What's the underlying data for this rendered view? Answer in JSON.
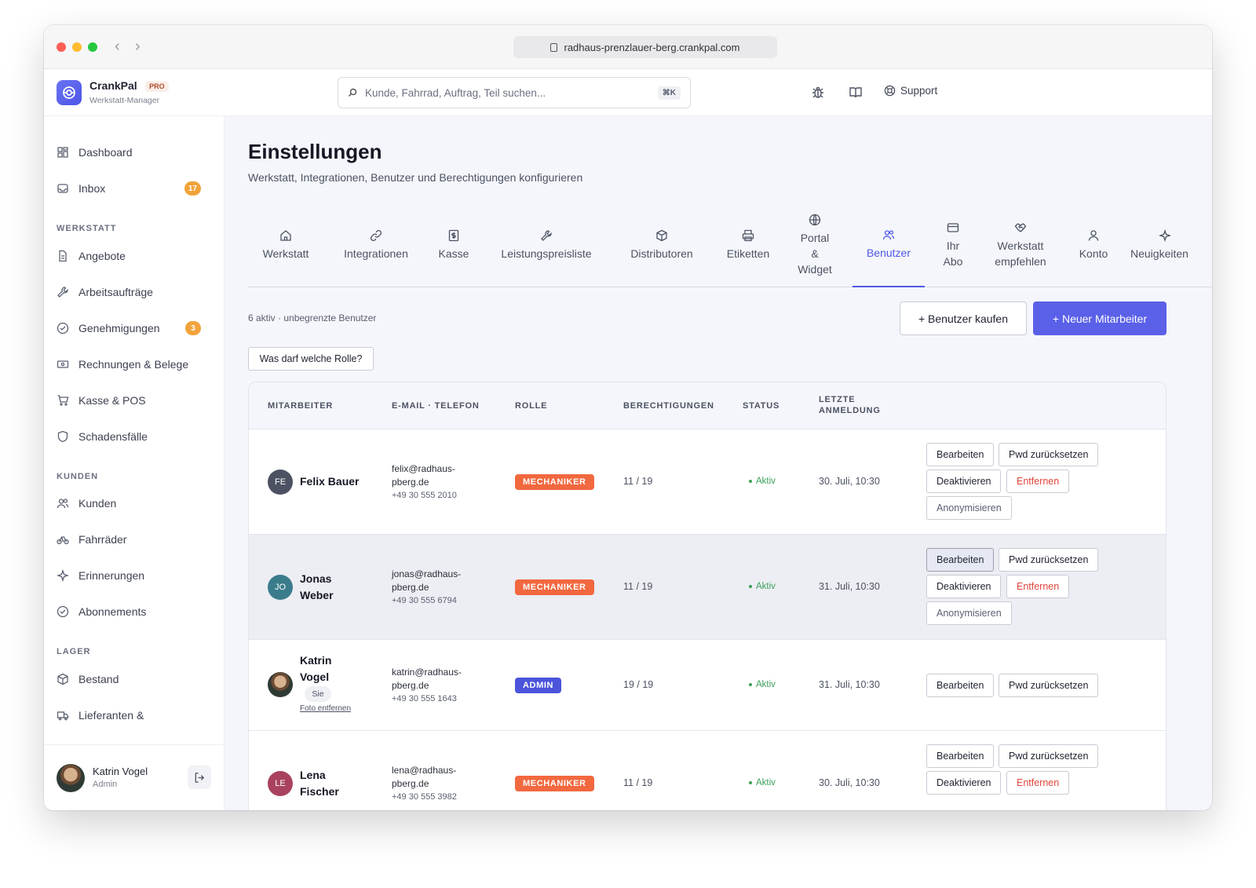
{
  "browser": {
    "url": "radhaus-prenzlauer-berg.crankpal.com"
  },
  "app": {
    "name": "CrankPal",
    "plan": "PRO",
    "subtitle": "Werkstatt-Manager"
  },
  "search": {
    "placeholder": "Kunde, Fahrrad, Auftrag, Teil suchen...",
    "shortcut": "⌘K"
  },
  "header": {
    "support_label": "Support"
  },
  "sidebar": {
    "dashboard": "Dashboard",
    "inbox": "Inbox",
    "inbox_count": "17",
    "section_workshop": "WERKSTATT",
    "angebote": "Angebote",
    "arbeitsauftraege": "Arbeitsaufträge",
    "genehmigungen": "Genehmigungen",
    "genehmigungen_count": "3",
    "rechnungen": "Rechnungen & Belege",
    "kasse": "Kasse & POS",
    "schadensfaelle": "Schadensfälle",
    "section_customers": "KUNDEN",
    "kunden": "Kunden",
    "fahrraeder": "Fahrräder",
    "erinnerungen": "Erinnerungen",
    "abonnements": "Abonnements",
    "section_stock": "LAGER",
    "bestand": "Bestand",
    "lieferanten": "Lieferanten &",
    "user_name": "Katrin Vogel",
    "user_role": "Admin"
  },
  "page": {
    "title": "Einstellungen",
    "subtitle": "Werkstatt, Integrationen, Benutzer und Berechtigungen konfigurieren"
  },
  "tabs": [
    "Werkstatt",
    "Integrationen",
    "Kasse",
    "Leistungspreisliste",
    "Distributoren",
    "Etiketten",
    "Portal\n&\nWidget",
    "Benutzer",
    "Ihr\nAbo",
    "Werkstatt\nempfehlen",
    "Konto",
    "Neuigkeiten"
  ],
  "users_section": {
    "meta": "6 aktiv · unbegrenzte Benutzer",
    "buy_button": "+ Benutzer kaufen",
    "new_button": "+ Neuer Mitarbeiter",
    "roles_button": "Was darf welche Rolle?"
  },
  "table": {
    "columns": [
      "MITARBEITER",
      "E-MAIL · TELEFON",
      "ROLLE",
      "BERECHTIGUNGEN",
      "STATUS",
      "LETZTE\nANMELDUNG"
    ],
    "rows": [
      {
        "initials": "FE",
        "name": "Felix Bauer",
        "email": "felix@radhaus-\npberg.de",
        "phone": "+49 30 555 2010",
        "role": "MECHANIKER",
        "perms": "11 / 19",
        "status": "Aktiv",
        "last_login": "30. Juli, 10:30"
      },
      {
        "initials": "JO",
        "name": "Jonas\nWeber",
        "email": "jonas@radhaus-\npberg.de",
        "phone": "+49 30 555 6794",
        "role": "MECHANIKER",
        "perms": "11 / 19",
        "status": "Aktiv",
        "last_login": "31. Juli, 10:30"
      },
      {
        "initials": "",
        "name": "Katrin\nVogel",
        "email": "katrin@radhaus-\npberg.de",
        "phone": "+49 30 555 1643",
        "role": "ADMIN",
        "perms": "19 / 19",
        "status": "Aktiv",
        "last_login": "31. Juli, 10:30",
        "you_badge": "Sie",
        "photo_link": "Foto entfernen"
      },
      {
        "initials": "LE",
        "name": "Lena\nFischer",
        "email": "lena@radhaus-\npberg.de",
        "phone": "+49 30 555 3982",
        "role": "MECHANIKER",
        "perms": "11 / 19",
        "status": "Aktiv",
        "last_login": "30. Juli, 10:30"
      }
    ],
    "actions": {
      "edit": "Bearbeiten",
      "reset_pwd": "Pwd zurücksetzen",
      "deactivate": "Deaktivieren",
      "remove": "Entfernen",
      "anonymize": "Anonymisieren"
    }
  },
  "colors": {
    "accent": "#5a60e8",
    "role_mechanic": "#f2683f",
    "role_admin": "#4b54db",
    "status_active": "#3aa05a",
    "badge_orange": "#f1a33b"
  }
}
